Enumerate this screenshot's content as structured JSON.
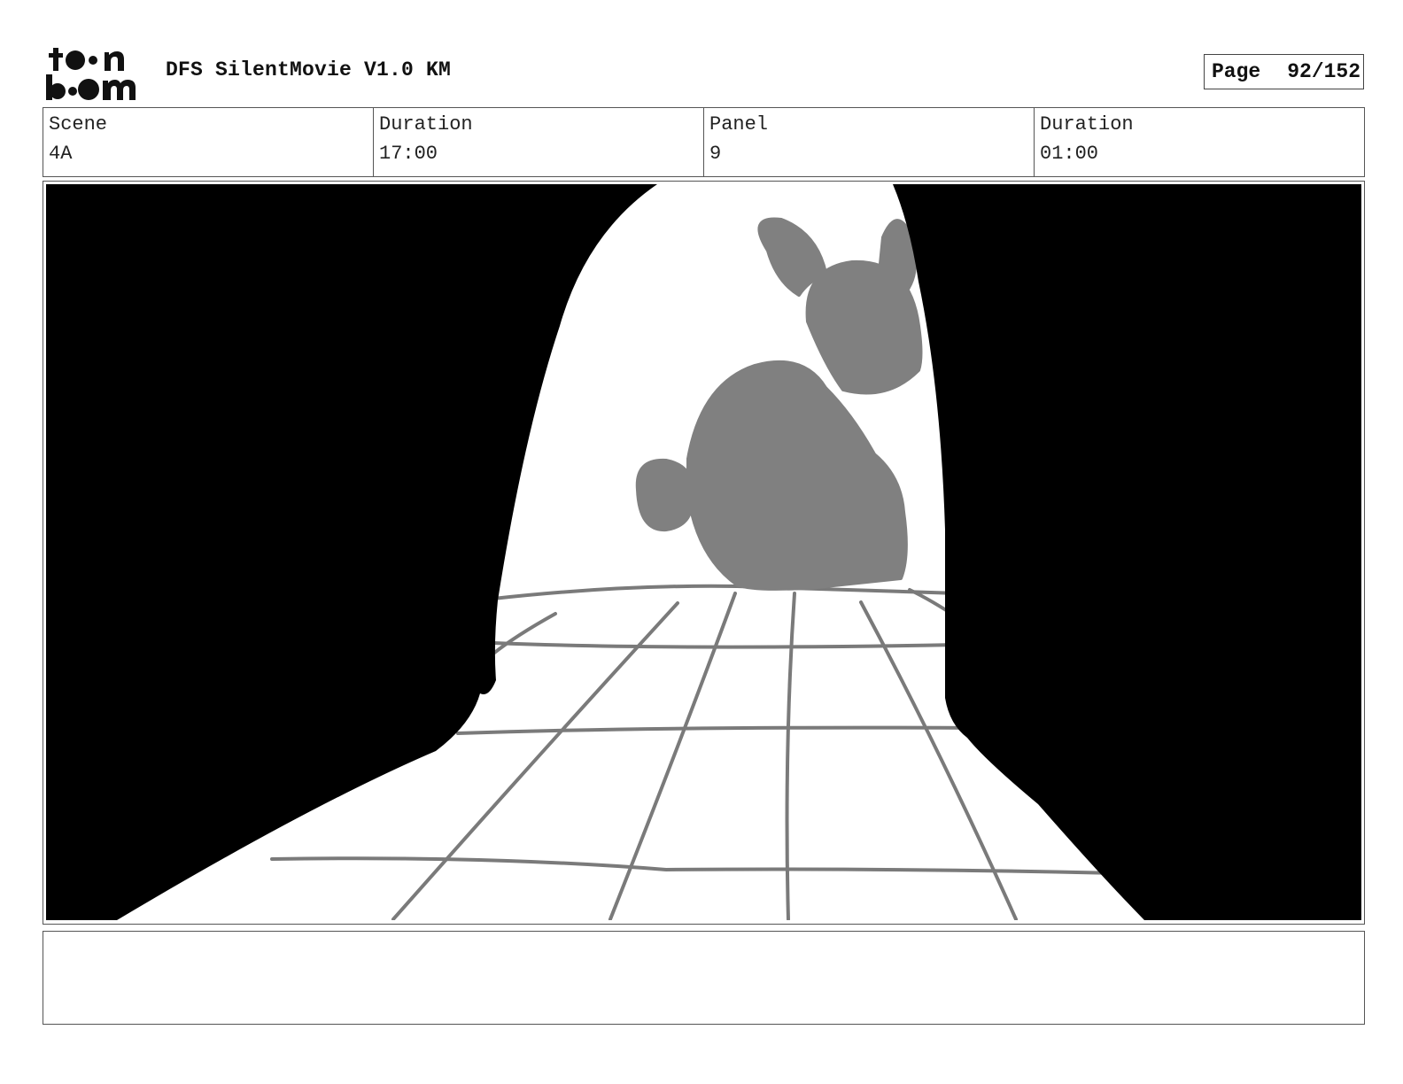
{
  "header": {
    "logo_text": "toon boom",
    "title": "DFS SilentMovie V1.0 KM",
    "page_label": "Page",
    "page_number": "92/152"
  },
  "info": {
    "scene_label": "Scene",
    "scene_value": "4A",
    "scene_duration_label": "Duration",
    "scene_duration_value": "17:00",
    "panel_label": "Panel",
    "panel_value": "9",
    "panel_duration_label": "Duration",
    "panel_duration_value": "01:00"
  },
  "panel": {
    "colors": {
      "silhouette": "#808080",
      "curtain": "#000000",
      "floor_lines": "#7a7a7a"
    }
  },
  "notes": {
    "text": ""
  }
}
